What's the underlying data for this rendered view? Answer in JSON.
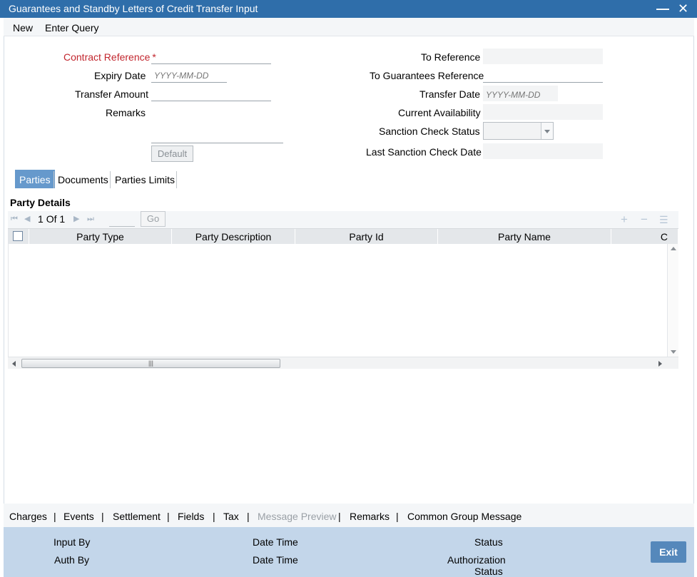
{
  "window": {
    "title": "Guarantees and Standby Letters of Credit Transfer Input"
  },
  "menu": {
    "new": "New",
    "enter_query": "Enter Query"
  },
  "form": {
    "contract_reference": {
      "label": "Contract Reference",
      "required_mark": "*",
      "value": ""
    },
    "expiry_date": {
      "label": "Expiry Date",
      "placeholder": "YYYY-MM-DD"
    },
    "transfer_amount": {
      "label": "Transfer Amount",
      "value": ""
    },
    "remarks": {
      "label": "Remarks",
      "value": ""
    },
    "default_button": "Default",
    "to_reference": {
      "label": "To Reference",
      "value": ""
    },
    "to_guarantees_reference": {
      "label": "To Guarantees Reference",
      "value": ""
    },
    "transfer_date": {
      "label": "Transfer Date",
      "placeholder": "YYYY-MM-DD"
    },
    "current_availability": {
      "label": "Current Availability",
      "value": ""
    },
    "sanction_check_status": {
      "label": "Sanction Check Status",
      "value": ""
    },
    "last_sanction_check_date": {
      "label": "Last Sanction Check Date",
      "value": ""
    }
  },
  "tabs": [
    {
      "label": "Parties",
      "active": true
    },
    {
      "label": "Documents",
      "active": false
    },
    {
      "label": "Parties Limits",
      "active": false
    }
  ],
  "party_details": {
    "title": "Party Details",
    "pager": {
      "current": "1",
      "of_label": "Of",
      "total": "1",
      "go": "Go"
    },
    "columns": [
      "Party Type",
      "Party Description",
      "Party Id",
      "Party Name",
      "C"
    ],
    "rows": []
  },
  "footer_links": [
    {
      "label": "Charges",
      "enabled": true
    },
    {
      "label": "Events",
      "enabled": true
    },
    {
      "label": "Settlement",
      "enabled": true
    },
    {
      "label": "Fields",
      "enabled": true
    },
    {
      "label": "Tax",
      "enabled": true
    },
    {
      "label": "Message Preview",
      "enabled": false
    },
    {
      "label": "Remarks",
      "enabled": true
    },
    {
      "label": "Common Group Message",
      "enabled": true
    }
  ],
  "audit": {
    "input_by": "Input By",
    "date_time_1": "Date Time",
    "status": "Status",
    "auth_by": "Auth By",
    "date_time_2": "Date Time",
    "authorization_status_1": "Authorization",
    "authorization_status_2": "Status",
    "exit": "Exit"
  },
  "colors": {
    "title_bar": "#2f6eaa",
    "active_tab": "#6699cc",
    "required_label": "#c2262e",
    "audit_bg": "#c3d6ea",
    "exit_button": "#5588bb"
  }
}
